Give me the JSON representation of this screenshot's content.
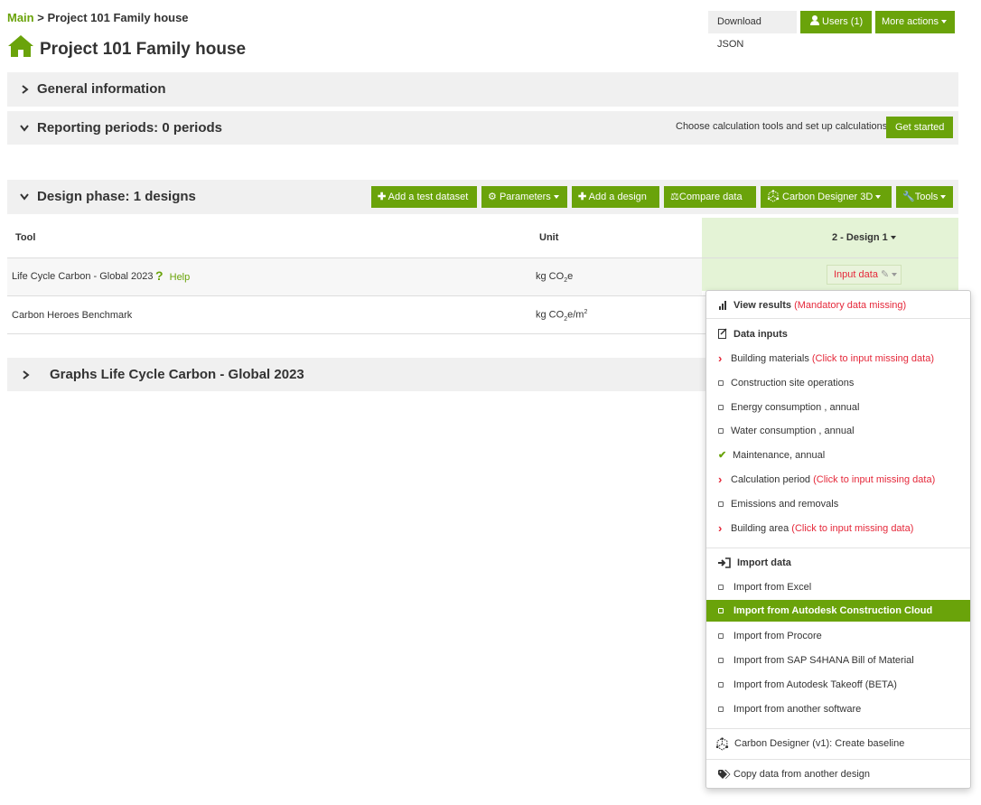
{
  "breadcrumb": {
    "root": "Main",
    "sep": ">",
    "current": "Project 101 Family house"
  },
  "page_title": "Project 101 Family house",
  "header_actions": {
    "download": "Download JSON",
    "users": "Users (1)",
    "more": "More actions"
  },
  "sections": {
    "general": "General information",
    "reporting": "Reporting periods: 0 periods",
    "reporting_hint": "Choose calculation tools and set up calculations",
    "get_started": "Get started",
    "design": "Design phase: 1 designs",
    "graphs": "Graphs Life Cycle Carbon - Global 2023"
  },
  "design_toolbar": {
    "add_test": "Add a test dataset",
    "parameters": "Parameters",
    "add_design": "Add a design",
    "compare": "Compare data",
    "carbon_designer": "Carbon Designer 3D",
    "tools": "Tools"
  },
  "table": {
    "col_tool": "Tool",
    "col_unit": "Unit",
    "col_design": "2 - Design 1",
    "rows": [
      {
        "tool": "Life Cycle Carbon - Global 2023",
        "help": "Help",
        "unit_pre": "kg CO",
        "unit_sub": "2",
        "unit_post": "e"
      },
      {
        "tool": "Carbon Heroes Benchmark",
        "unit_pre": "kg CO",
        "unit_sub": "2",
        "unit_post": "e/m",
        "unit_sup": "2"
      }
    ],
    "input_data": "Input data"
  },
  "menu": {
    "view_results": "View results",
    "view_results_note": "(Mandatory data missing)",
    "data_inputs": "Data inputs",
    "items": [
      {
        "label": "Building materials",
        "note": "(Click to input missing data)",
        "state": "missing"
      },
      {
        "label": "Construction site operations",
        "note": "",
        "state": "empty"
      },
      {
        "label": "Energy consumption , annual",
        "note": "",
        "state": "empty"
      },
      {
        "label": "Water consumption , annual",
        "note": "",
        "state": "empty"
      },
      {
        "label": "Maintenance, annual",
        "note": "",
        "state": "done"
      },
      {
        "label": "Calculation period",
        "note": "(Click to input missing data)",
        "state": "missing"
      },
      {
        "label": "Emissions and removals",
        "note": "",
        "state": "empty"
      },
      {
        "label": "Building area",
        "note": "(Click to input missing data)",
        "state": "missing"
      }
    ],
    "import_data": "Import data",
    "imports": [
      "Import from Excel",
      "Import from Autodesk Construction Cloud",
      "Import from Procore",
      "Import from SAP S4HANA Bill of Material",
      "Import from Autodesk Takeoff (BETA)",
      "Import from another software"
    ],
    "carbon_designer": "Carbon Designer (v1): Create baseline",
    "copy_data": "Copy data from another design"
  },
  "colors": {
    "accent": "#6aa30a",
    "missing": "#e5283a",
    "highlight_col": "#e4f3d6"
  }
}
